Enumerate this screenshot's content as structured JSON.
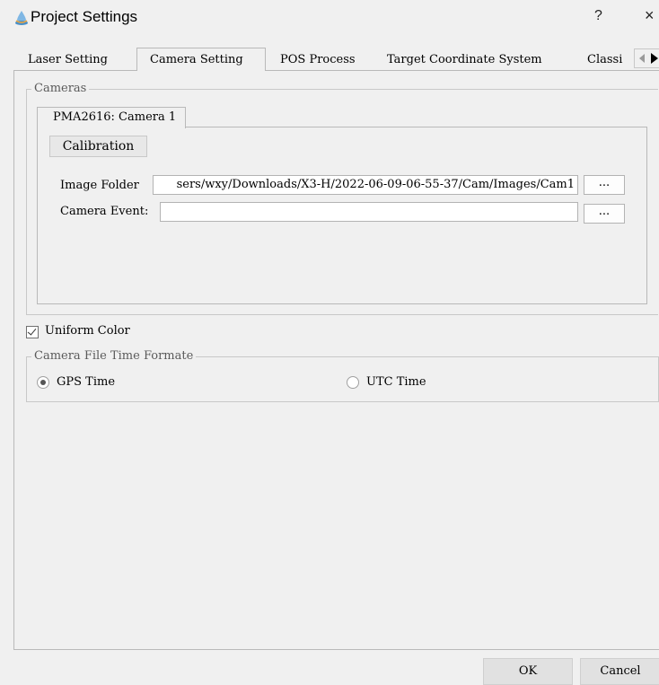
{
  "window": {
    "title": "Project Settings",
    "help_label": "?",
    "close_label": "×",
    "icon": "app-icon"
  },
  "tabs": [
    {
      "label": "Laser Setting",
      "selected": false
    },
    {
      "label": "Camera Setting",
      "selected": true
    },
    {
      "label": "POS Process",
      "selected": false
    },
    {
      "label": "Target Coordinate System",
      "selected": false
    },
    {
      "label": "Classi",
      "selected": false
    }
  ],
  "tab_scroll": {
    "left_icon": "arrow-left-icon",
    "right_icon": "arrow-right-icon"
  },
  "cameras": {
    "group_label": "Cameras",
    "camera_tab_label": "PMA2616: Camera 1",
    "calibration_label": "Calibration",
    "image_folder_label": "Image Folder",
    "image_folder_value": "sers/wxy/Downloads/X3-H/2022-06-09-06-55-37/Cam/Images/Cam1",
    "camera_event_label": "Camera Event:",
    "camera_event_value": "",
    "browse_label": "..."
  },
  "uniform_color": {
    "label": "Uniform Color",
    "checked": true
  },
  "time_format": {
    "group_label": "Camera File Time Formate",
    "options": [
      {
        "label": "GPS Time",
        "selected": true
      },
      {
        "label": "UTC Time",
        "selected": false
      }
    ]
  },
  "buttons": {
    "ok": "OK",
    "cancel": "Cancel"
  }
}
